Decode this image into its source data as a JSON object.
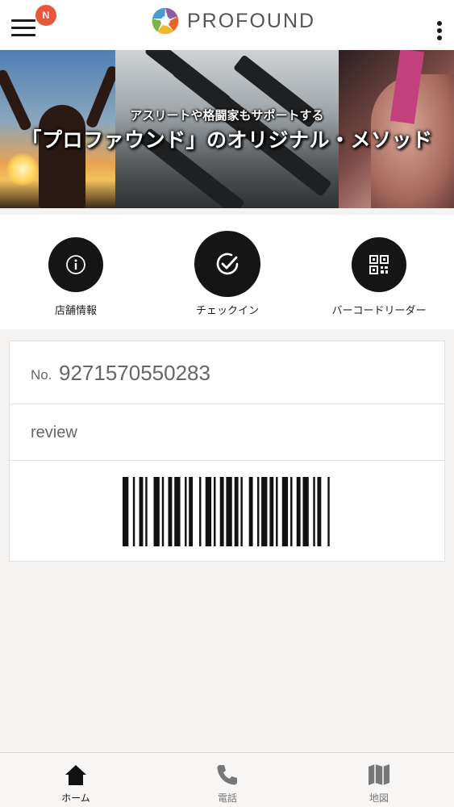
{
  "header": {
    "notification_badge": "N",
    "brand_name": "PROFOUND",
    "menu_icon": "hamburger-menu-icon",
    "more_icon": "vertical-dots-icon"
  },
  "hero": {
    "subtitle": "アスリートや格闘家もサポートする",
    "title": "「プロファウンド」のオリジナル・メソッド"
  },
  "shortcuts": [
    {
      "label": "店舗情報",
      "icon": "info-icon"
    },
    {
      "label": "チェックイン",
      "icon": "checkmark-icon"
    },
    {
      "label": "バーコードリーダー",
      "icon": "qr-code-icon"
    }
  ],
  "member_card": {
    "number_prefix": "No.",
    "number": "9271570550283",
    "review": "review",
    "barcode_icon": "barcode-icon"
  },
  "tabbar": {
    "items": [
      {
        "label": "ホーム",
        "icon": "home-icon",
        "active": true
      },
      {
        "label": "電話",
        "icon": "phone-icon",
        "active": false
      },
      {
        "label": "地図",
        "icon": "map-icon",
        "active": false
      }
    ]
  },
  "colors": {
    "background": "#f4f3f2",
    "badge": "#e8563b",
    "icon_circle": "#151515",
    "text_muted": "#666666"
  }
}
